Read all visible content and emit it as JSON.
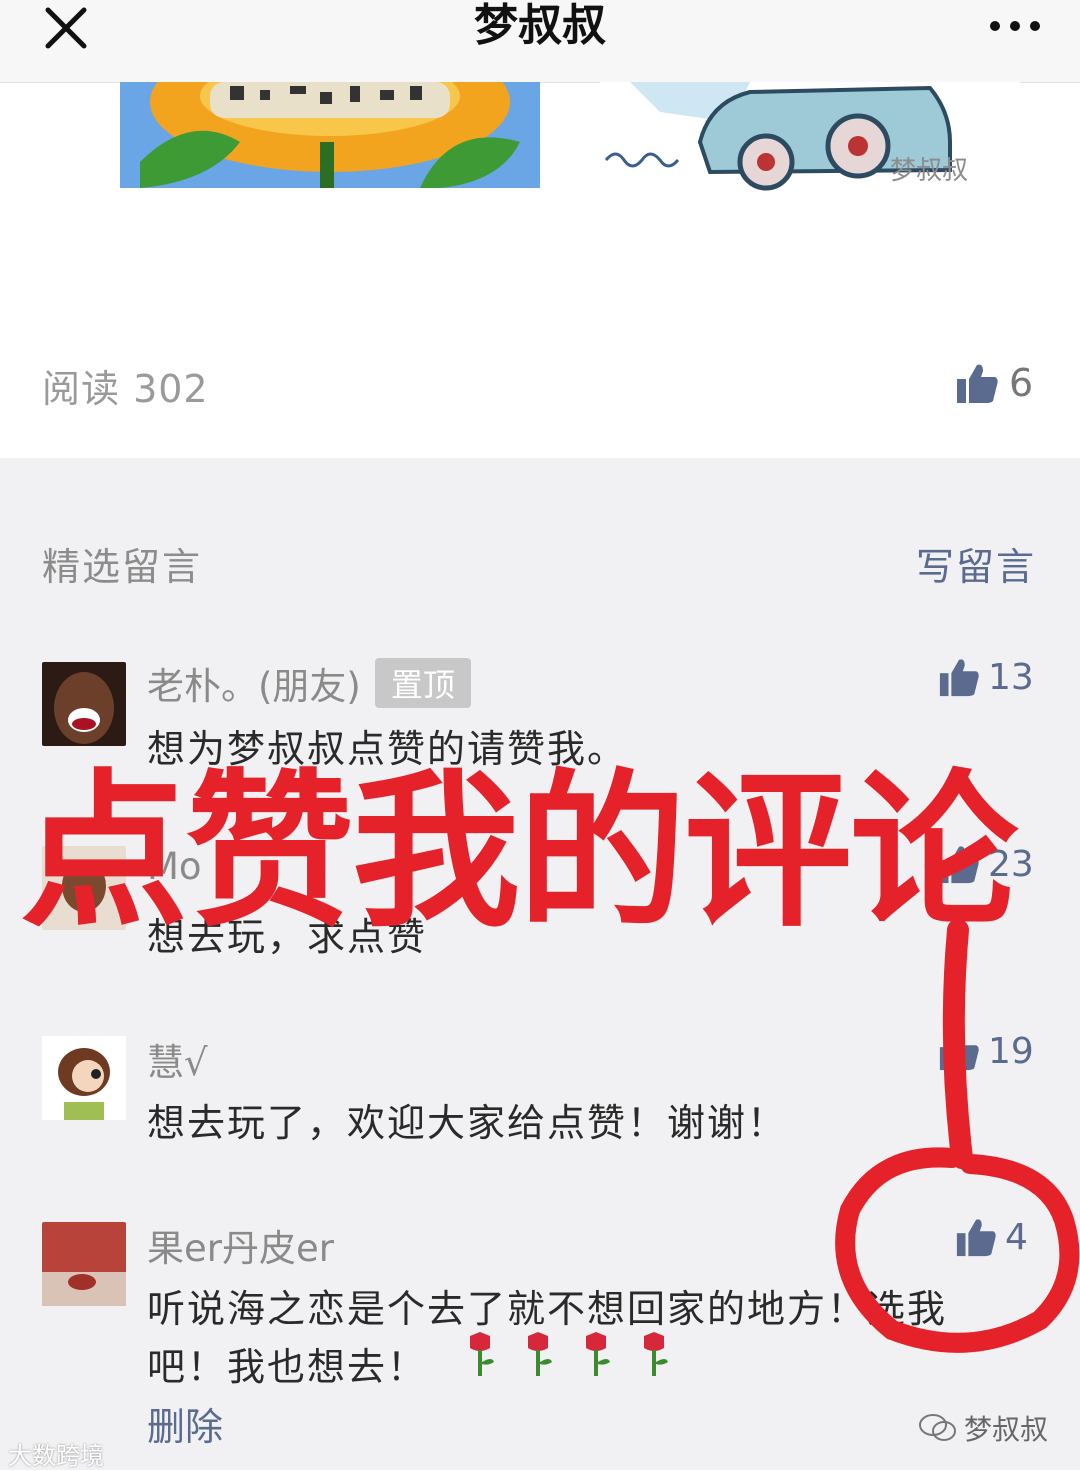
{
  "header": {
    "title": "梦叔叔",
    "close_icon": "close-icon",
    "more_icon": "more-icon"
  },
  "article": {
    "image_watermark": "梦叔叔",
    "read_label": "阅读 302",
    "like_count": "6"
  },
  "comments_section": {
    "title": "精选留言",
    "write_label": "写留言",
    "comments": [
      {
        "name": "老朴。(朋友)",
        "badge": "置顶",
        "text": "想为梦叔叔点赞的请赞我。",
        "likes": "13"
      },
      {
        "name": "Mo",
        "text": "想去玩，求点赞",
        "likes": "23"
      },
      {
        "name": "慧√",
        "text": "想去玩了，欢迎大家给点赞！谢谢！",
        "likes": "19"
      },
      {
        "name": "果er丹皮er",
        "text_line1": "听说海之恋是个去了就不想回家的地方！选我",
        "text_line2": "吧！我也想去！",
        "likes": "4"
      }
    ],
    "delete_label": "删除"
  },
  "overlay": {
    "caption": "点赞我的评论"
  },
  "watermarks": {
    "bottom_left": "大数跨境",
    "bottom_right": "梦叔叔"
  },
  "colors": {
    "accent": "#5a6b8f",
    "overlay_red": "#e5222a",
    "section_bg": "#f1f1f3"
  }
}
